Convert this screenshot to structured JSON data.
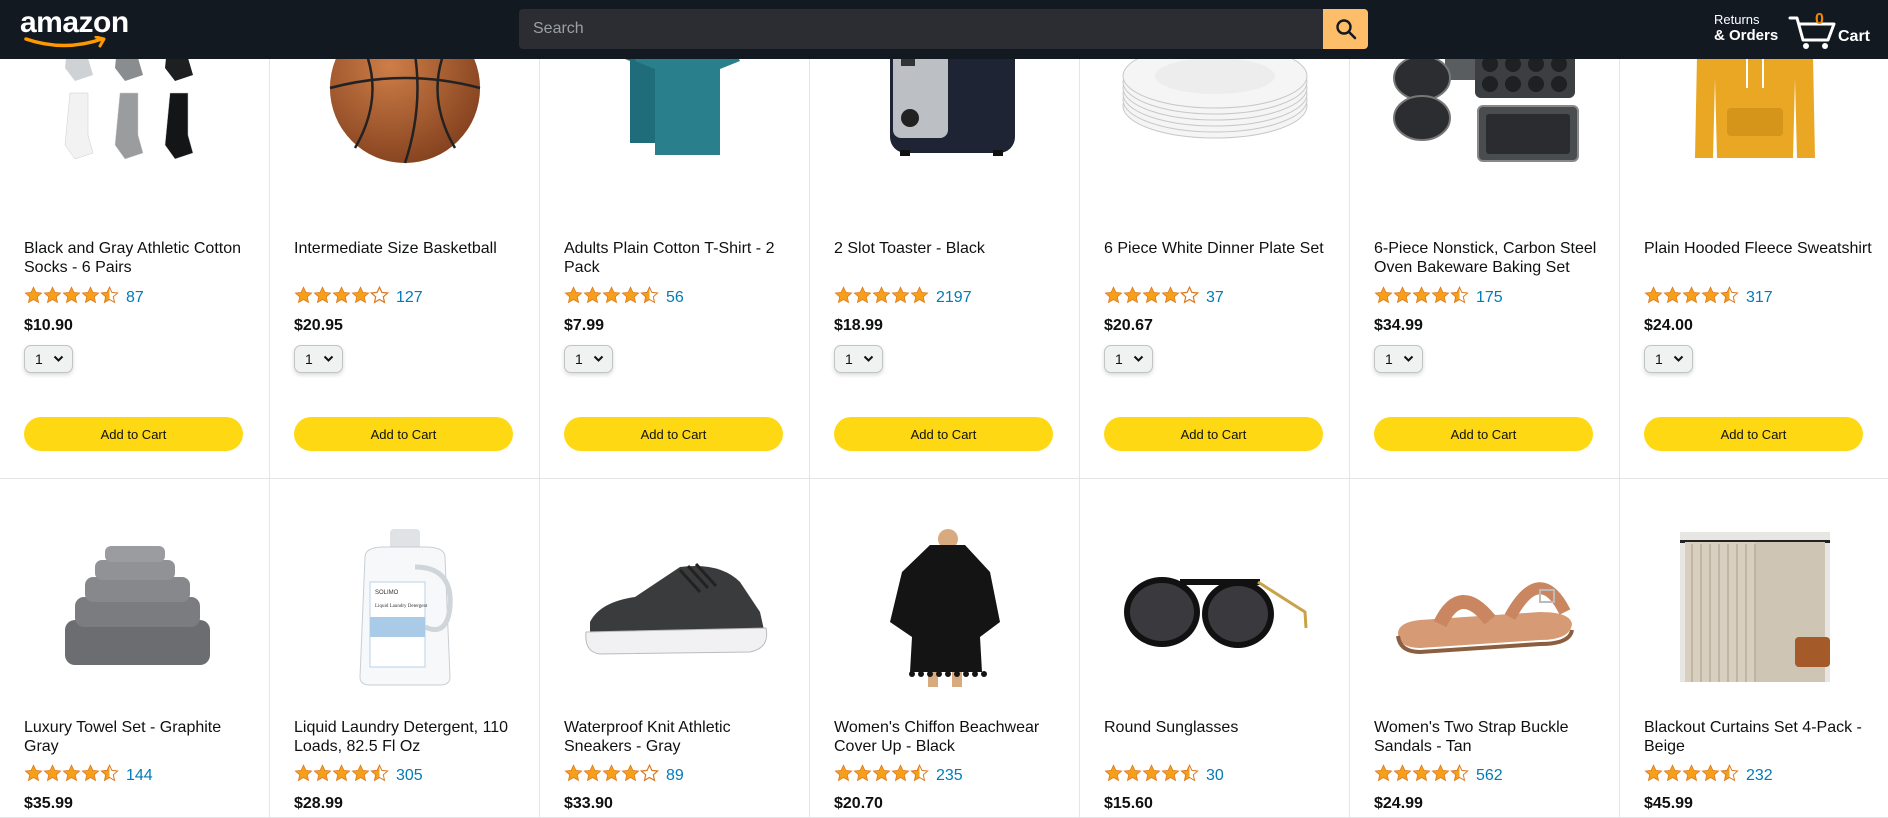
{
  "header": {
    "logo": "amazon",
    "search_placeholder": "Search",
    "returns_line1": "Returns",
    "returns_line2": "& Orders",
    "cart_count": "0",
    "cart_label": "Cart",
    "colors": {
      "bar": "#131921",
      "search_button": "#febd69",
      "cart_count": "#f08804"
    }
  },
  "rows": [
    {
      "products": [
        {
          "title": "Black and Gray Athletic Cotton Socks - 6 Pairs",
          "rating": 4.5,
          "rating_count": "87",
          "price": "$10.90",
          "qty": "1",
          "button": "Add to Cart",
          "image": "socks"
        },
        {
          "title": "Intermediate Size Basketball",
          "rating": 4.0,
          "rating_count": "127",
          "price": "$20.95",
          "qty": "1",
          "button": "Add to Cart",
          "image": "basketball"
        },
        {
          "title": "Adults Plain Cotton T-Shirt - 2 Pack",
          "rating": 4.5,
          "rating_count": "56",
          "price": "$7.99",
          "qty": "1",
          "button": "Add to Cart",
          "image": "tshirt"
        },
        {
          "title": "2 Slot Toaster - Black",
          "rating": 5.0,
          "rating_count": "2197",
          "price": "$18.99",
          "qty": "1",
          "button": "Add to Cart",
          "image": "toaster"
        },
        {
          "title": "6 Piece White Dinner Plate Set",
          "rating": 4.0,
          "rating_count": "37",
          "price": "$20.67",
          "qty": "1",
          "button": "Add to Cart",
          "image": "plates"
        },
        {
          "title": "6-Piece Nonstick, Carbon Steel Oven Bakeware Baking Set",
          "rating": 4.5,
          "rating_count": "175",
          "price": "$34.99",
          "qty": "1",
          "button": "Add to Cart",
          "image": "bakeware"
        },
        {
          "title": "Plain Hooded Fleece Sweatshirt",
          "rating": 4.5,
          "rating_count": "317",
          "price": "$24.00",
          "qty": "1",
          "button": "Add to Cart",
          "image": "hoodie"
        }
      ]
    },
    {
      "products": [
        {
          "title": "Luxury Towel Set - Graphite Gray",
          "rating": 4.5,
          "rating_count": "144",
          "price": "$35.99",
          "image": "towels"
        },
        {
          "title": "Liquid Laundry Detergent, 110 Loads, 82.5 Fl Oz",
          "rating": 4.5,
          "rating_count": "305",
          "price": "$28.99",
          "image": "detergent",
          "label_brand": "SOLIMO",
          "label_text": "Liquid Laundry Detergent"
        },
        {
          "title": "Waterproof Knit Athletic Sneakers - Gray",
          "rating": 4.0,
          "rating_count": "89",
          "price": "$33.90",
          "image": "sneaker"
        },
        {
          "title": "Women's Chiffon Beachwear Cover Up - Black",
          "rating": 4.5,
          "rating_count": "235",
          "price": "$20.70",
          "image": "coverup"
        },
        {
          "title": "Round Sunglasses",
          "rating": 4.5,
          "rating_count": "30",
          "price": "$15.60",
          "image": "sunglasses"
        },
        {
          "title": "Women's Two Strap Buckle Sandals - Tan",
          "rating": 4.5,
          "rating_count": "562",
          "price": "$24.99",
          "image": "sandal"
        },
        {
          "title": "Blackout Curtains Set 4-Pack - Beige",
          "rating": 4.5,
          "rating_count": "232",
          "price": "$45.99",
          "image": "curtains"
        }
      ]
    }
  ]
}
